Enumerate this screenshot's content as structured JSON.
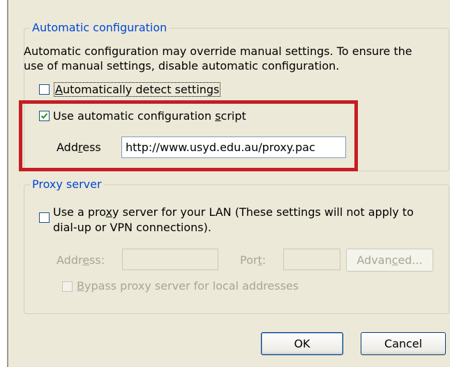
{
  "automatic_configuration": {
    "legend": "Automatic configuration",
    "description_line1": "Automatic configuration may override manual settings.  To ensure the",
    "description_line2": "use of manual settings, disable automatic configuration.",
    "auto_detect": {
      "before": "",
      "accel": "A",
      "after": "utomatically detect settings",
      "checked": false
    },
    "use_script": {
      "before": "Use automatic configuration ",
      "accel": "s",
      "after": "cript",
      "checked": true
    },
    "address_label": {
      "before": "Add",
      "accel": "r",
      "after": "ess"
    },
    "address_value": "http://www.usyd.edu.au/proxy.pac"
  },
  "proxy_server": {
    "legend": "Proxy server",
    "use_proxy_line1_before": "Use a pro",
    "use_proxy_line1_accel": "x",
    "use_proxy_line1_after": "y server for your LAN (These settings will not apply to",
    "use_proxy_line2": "dial-up or VPN connections).",
    "use_proxy_checked": false,
    "address_label": {
      "before": "Addr",
      "accel": "e",
      "after": "ss:"
    },
    "address_value": "",
    "port_label": {
      "before": "Por",
      "accel": "t",
      "after": ":"
    },
    "port_value": "",
    "advanced_button": {
      "before": "Advan",
      "accel": "c",
      "after": "ed..."
    },
    "bypass": {
      "before": "",
      "accel": "B",
      "after": "ypass proxy server for local addresses",
      "checked": false
    }
  },
  "buttons": {
    "ok": "OK",
    "cancel": "Cancel"
  },
  "colors": {
    "dialog_bg": "#ece9d8",
    "legend_blue": "#0046d5",
    "highlight_red": "#c51d23",
    "check_green": "#21a121",
    "disabled_text": "#a8a597"
  }
}
